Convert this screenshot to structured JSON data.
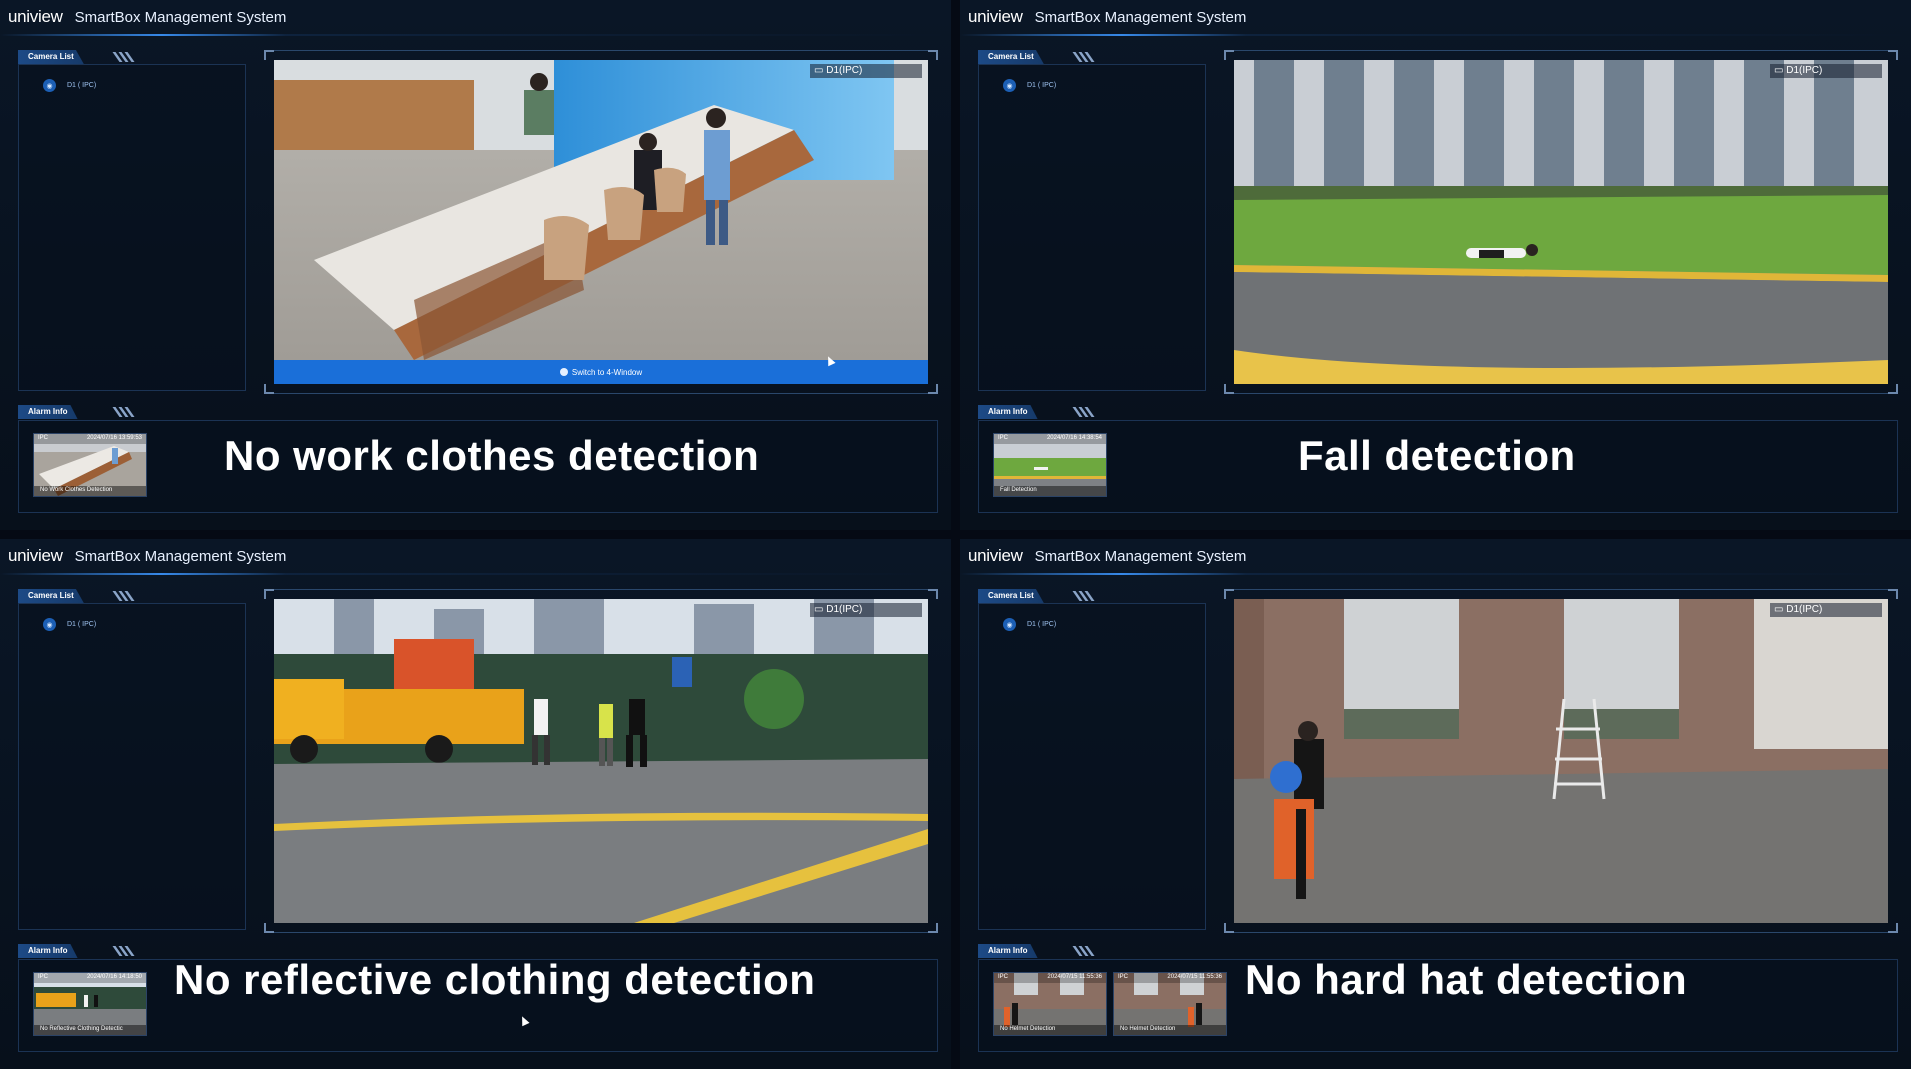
{
  "quadrants": [
    {
      "logo": "uniview",
      "title": "SmartBox Management System",
      "camera_list_label": "Camera List",
      "camera_item": "D1 ( IPC)",
      "video_label": "D1(IPC)",
      "switch_label": "Switch to 4-Window",
      "alarm_info_label": "Alarm Info",
      "alarms": [
        {
          "source": "IPC",
          "time": "2024/07/16 13:59:53",
          "caption": "No Work Clothes Detection"
        }
      ],
      "big_caption": "No work clothes detection"
    },
    {
      "logo": "uniview",
      "title": "SmartBox Management System",
      "camera_list_label": "Camera List",
      "camera_item": "D1 ( IPC)",
      "video_label": "D1(IPC)",
      "alarm_info_label": "Alarm Info",
      "alarms": [
        {
          "source": "IPC",
          "time": "2024/07/16 14:38:54",
          "caption": "Fall Detection"
        }
      ],
      "big_caption": "Fall detection"
    },
    {
      "logo": "uniview",
      "title": "SmartBox Management System",
      "camera_list_label": "Camera List",
      "camera_item": "D1 ( IPC)",
      "video_label": "D1(IPC)",
      "alarm_info_label": "Alarm Info",
      "alarms": [
        {
          "source": "IPC",
          "time": "2024/07/16 14:18:50",
          "caption": "No Reflective Clothing Detectic"
        }
      ],
      "big_caption": "No reflective clothing detection"
    },
    {
      "logo": "uniview",
      "title": "SmartBox Management System",
      "camera_list_label": "Camera List",
      "camera_item": "D1 ( IPC)",
      "video_label": "D1(IPC)",
      "alarm_info_label": "Alarm Info",
      "alarms": [
        {
          "source": "IPC",
          "time": "2024/07/15 11:55:36",
          "caption": "No Helmet Detection"
        },
        {
          "source": "IPC",
          "time": "2024/07/15 11:55:36",
          "caption": "No Helmet Detection"
        }
      ],
      "big_caption": "No hard hat detection"
    }
  ],
  "colors": {
    "background": "#07101b",
    "accent": "#1a6fd9",
    "panel_border": "#1b3354",
    "tab_bg": "#1d4a86",
    "caption": "#ffffff"
  }
}
